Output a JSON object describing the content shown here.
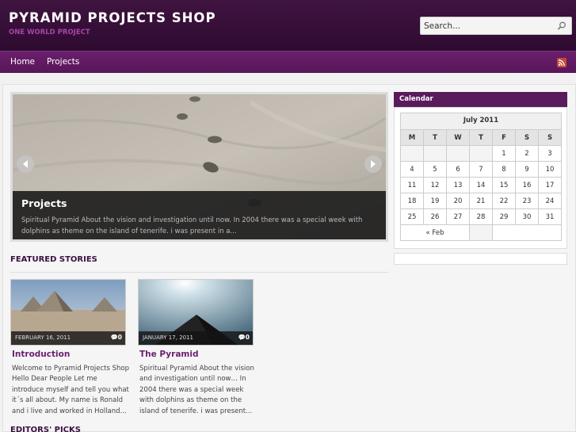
{
  "site": {
    "title": "PYRAMID PROJECTS SHOP",
    "description": "ONE WORLD PROJECT"
  },
  "search": {
    "placeholder": "Search..."
  },
  "nav": {
    "items": [
      "Home",
      "Projects"
    ]
  },
  "slider": {
    "title": "Projects",
    "text": "Spiritual Pyramid About the vision and investigation until now. In 2004 there was a special week with dolphins as theme on the island of tenerife. i was present in a..."
  },
  "featured": {
    "heading": "FEATURED STORIES",
    "posts": [
      {
        "date": "FEBRUARY 16, 2011",
        "comments": "0",
        "title": "Introduction",
        "excerpt": "Welcome to Pyramid Projects Shop Hello Dear People Let me introduce myself and tell you what it´s all about. My name is Ronald and i live and worked in Holland..."
      },
      {
        "date": "JANUARY 17, 2011",
        "comments": "0",
        "title": "The Pyramid",
        "excerpt": "Spiritual Pyramid About the vision and investigation until now… In 2004 there was a special week with dolphins as theme on the island of tenerife. i was present..."
      }
    ]
  },
  "editors": {
    "heading": "EDITORS' PICKS"
  },
  "calendar": {
    "heading": "Calendar",
    "month": "July 2011",
    "weekdays": [
      "M",
      "T",
      "W",
      "T",
      "F",
      "S",
      "S"
    ],
    "weeks": [
      [
        "",
        "",
        "",
        "",
        "1",
        "2",
        "3"
      ],
      [
        "4",
        "5",
        "6",
        "7",
        "8",
        "9",
        "10"
      ],
      [
        "11",
        "12",
        "13",
        "14",
        "15",
        "16",
        "17"
      ],
      [
        "18",
        "19",
        "20",
        "21",
        "22",
        "23",
        "24"
      ],
      [
        "25",
        "26",
        "27",
        "28",
        "29",
        "30",
        "31"
      ]
    ],
    "prev": "« Feb"
  },
  "colors": {
    "header": "#2e0a30",
    "nav": "#5e185f",
    "accent": "#6b1f6e"
  }
}
